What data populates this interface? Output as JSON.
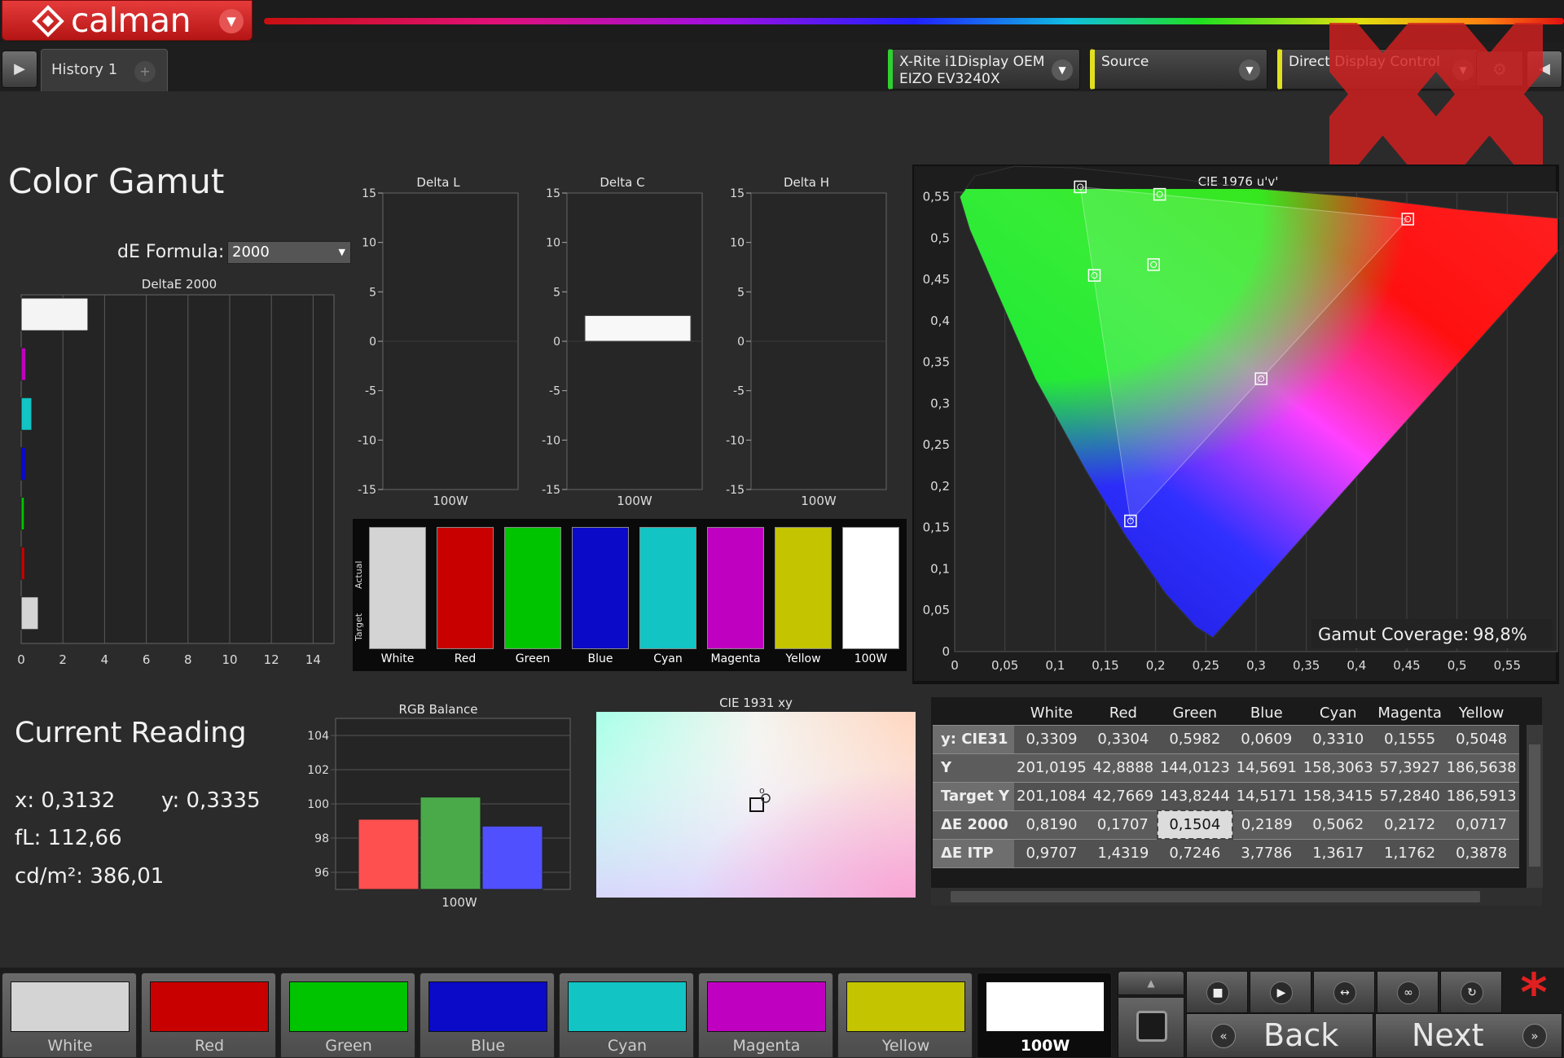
{
  "app": {
    "logo_text": "calman",
    "tab_label": "History 1",
    "tab_add": "+"
  },
  "devices": {
    "meter_line1": "X-Rite i1Display OEM",
    "meter_line2": "EIZO EV3240X",
    "source": "Source",
    "display": "Direct Display Control"
  },
  "page": {
    "title": "Color Gamut",
    "reading_title": "Current Reading"
  },
  "de_formula": {
    "label": "dE Formula:",
    "value": "2000"
  },
  "colors": {
    "accent_red": "#d42020",
    "white": "#d4d4d4",
    "red": "#c80000",
    "green": "#00c400",
    "blue": "#0a0ac8",
    "cyan": "#12c4c4",
    "magenta": "#c000c0",
    "yellow": "#c4c400",
    "w100": "#ffffff"
  },
  "chart_data": [
    {
      "type": "bar",
      "title": "DeltaE 2000",
      "orientation": "horizontal",
      "categories": [
        "100W",
        "Magenta",
        "Cyan",
        "Blue",
        "Green",
        "Red",
        "White"
      ],
      "values": [
        3.2,
        0.2172,
        0.5062,
        0.2189,
        0.1504,
        0.1707,
        0.819
      ],
      "xlim": [
        0,
        15
      ],
      "xticks": [
        "0",
        "2",
        "4",
        "6",
        "8",
        "10",
        "12",
        "14"
      ]
    },
    {
      "type": "bar",
      "title": "Delta L",
      "categories": [
        "100W"
      ],
      "values": [
        0
      ],
      "ylim": [
        -15,
        15
      ],
      "yticks": [
        "15",
        "10",
        "5",
        "0",
        "-5",
        "-10",
        "-15"
      ]
    },
    {
      "type": "bar",
      "title": "Delta C",
      "categories": [
        "100W"
      ],
      "values": [
        2.6
      ],
      "ylim": [
        -15,
        15
      ],
      "yticks": [
        "15",
        "10",
        "5",
        "0",
        "-5",
        "-10",
        "-15"
      ]
    },
    {
      "type": "bar",
      "title": "Delta H",
      "categories": [
        "100W"
      ],
      "values": [
        0
      ],
      "ylim": [
        -15,
        15
      ],
      "yticks": [
        "15",
        "10",
        "5",
        "0",
        "-5",
        "-10",
        "-15"
      ]
    },
    {
      "type": "scatter",
      "title": "CIE 1976 u'v'",
      "xlim": [
        0,
        0.6
      ],
      "ylim": [
        0,
        0.6
      ],
      "xticks": [
        "0",
        "0,05",
        "0,1",
        "0,15",
        "0,2",
        "0,25",
        "0,3",
        "0,35",
        "0,4",
        "0,45",
        "0,5",
        "0,55"
      ],
      "yticks": [
        "0",
        "0,05",
        "0,1",
        "0,15",
        "0,2",
        "0,25",
        "0,3",
        "0,35",
        "0,4",
        "0,45",
        "0,5",
        "0,55"
      ],
      "target_points": [
        {
          "name": "Red",
          "u": 0.451,
          "v": 0.523
        },
        {
          "name": "Green",
          "u": 0.125,
          "v": 0.562
        },
        {
          "name": "Blue",
          "u": 0.175,
          "v": 0.158
        },
        {
          "name": "Cyan",
          "u": 0.139,
          "v": 0.455
        },
        {
          "name": "Magenta",
          "u": 0.305,
          "v": 0.33
        },
        {
          "name": "Yellow",
          "u": 0.204,
          "v": 0.553
        },
        {
          "name": "White",
          "u": 0.198,
          "v": 0.468
        }
      ],
      "gamut_coverage": "98,8%",
      "gamut_coverage_label": "Gamut Coverage:"
    },
    {
      "type": "bar",
      "title": "RGB Balance",
      "categories": [
        "100W"
      ],
      "series": [
        {
          "name": "R",
          "values": [
            99.1
          ]
        },
        {
          "name": "G",
          "values": [
            100.4
          ]
        },
        {
          "name": "B",
          "values": [
            98.7
          ]
        }
      ],
      "ylim": [
        95,
        105
      ],
      "yticks": [
        "104",
        "102",
        "100",
        "98",
        "96"
      ]
    },
    {
      "type": "scatter",
      "title": "CIE 1931 xy",
      "actual": {
        "x": 0.3132,
        "y": 0.3335
      }
    }
  ],
  "swatch_grid": {
    "actual_label": "Actual",
    "target_label": "Target",
    "items": [
      "White",
      "Red",
      "Green",
      "Blue",
      "Cyan",
      "Magenta",
      "Yellow",
      "100W"
    ]
  },
  "reading": {
    "x": "x: 0,3132",
    "y": "y: 0,3335",
    "fl": "fL: 112,66",
    "cdm2": "cd/m²: 386,01"
  },
  "table": {
    "columns": [
      "White",
      "Red",
      "Green",
      "Blue",
      "Cyan",
      "Magenta",
      "Yellow"
    ],
    "rows": [
      {
        "label": "y: CIE31",
        "values": [
          "0,3309",
          "0,3304",
          "0,5982",
          "0,0609",
          "0,3310",
          "0,1555",
          "0,5048"
        ]
      },
      {
        "label": "Y",
        "values": [
          "201,0195",
          "42,8888",
          "144,0123",
          "14,5691",
          "158,3063",
          "57,3927",
          "186,5638"
        ]
      },
      {
        "label": "Target Y",
        "values": [
          "201,1084",
          "42,7669",
          "143,8244",
          "14,5171",
          "158,3415",
          "57,2840",
          "186,5913"
        ]
      },
      {
        "label": "ΔE 2000",
        "values": [
          "0,8190",
          "0,1707",
          "0,1504",
          "0,2189",
          "0,5062",
          "0,2172",
          "0,0717"
        ]
      },
      {
        "label": "ΔE ITP",
        "values": [
          "0,9707",
          "1,4319",
          "0,7246",
          "3,7786",
          "1,3617",
          "1,1762",
          "0,3878"
        ]
      }
    ]
  },
  "patches": [
    "White",
    "Red",
    "Green",
    "Blue",
    "Cyan",
    "Magenta",
    "Yellow",
    "100W"
  ],
  "nav": {
    "back": "Back",
    "next": "Next"
  },
  "icons": {
    "play": "play-icon",
    "stop": "stop-icon",
    "measure": "measure-icon",
    "loop": "loop-icon",
    "refresh": "refresh-icon",
    "star": "star-icon"
  }
}
